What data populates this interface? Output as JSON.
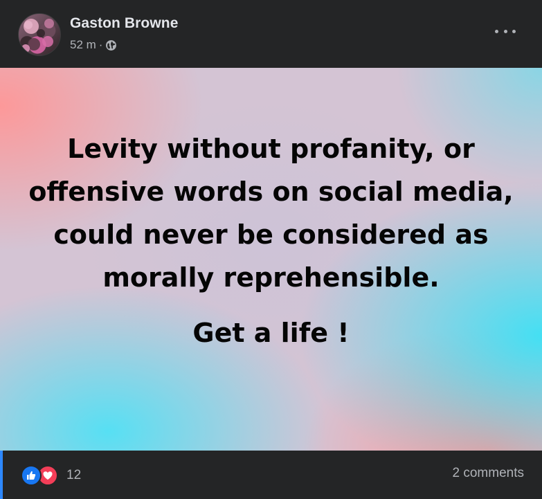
{
  "post": {
    "author": "Gaston Browne",
    "time": "52 m",
    "separator": "·",
    "audience_icon": "globe-icon",
    "more_icon": "more-options-icon"
  },
  "background_post": {
    "lines": [
      "Levity without profanity, or offensive words on social media, could never be considered as morally reprehensible."
    ],
    "closing": "Get a life !",
    "colors": {
      "pink": "#ff9a9a",
      "cyan": "#3ce1f5",
      "lavender": "#cdc3d7",
      "text": "#050505"
    }
  },
  "footer": {
    "reaction_icons": [
      "like-icon",
      "love-icon"
    ],
    "reaction_count": "12",
    "comments_label": "2 comments"
  },
  "theme": {
    "card_bg": "#242526",
    "primary_text": "#e4e6eb",
    "secondary_text": "#b0b3b8",
    "accent": "#2d88ff"
  }
}
